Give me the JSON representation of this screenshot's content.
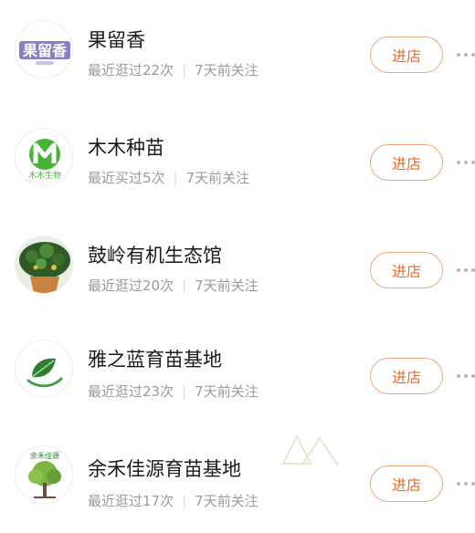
{
  "enter_label": "进店",
  "stores": [
    {
      "name": "果留香",
      "recent": "最近逛过22次",
      "follow": "7天前关注",
      "avatar_icon": "guoliuxiang-logo-icon",
      "logo_text": "果留香"
    },
    {
      "name": "木木种苗",
      "recent": "最近买过5次",
      "follow": "7天前关注",
      "avatar_icon": "mumu-logo-icon",
      "logo_text": "木木生物"
    },
    {
      "name": "鼓岭有机生态馆",
      "recent": "最近逛过20次",
      "follow": "7天前关注",
      "avatar_icon": "plant-photo-icon"
    },
    {
      "name": "雅之蓝育苗基地",
      "recent": "最近逛过23次",
      "follow": "7天前关注",
      "avatar_icon": "leaf-logo-icon"
    },
    {
      "name": "余禾佳源育苗基地",
      "recent": "最近逛过17次",
      "follow": "7天前关注",
      "avatar_icon": "tree-logo-icon",
      "logo_text": "余禾佳源"
    }
  ],
  "colors": {
    "accent": "#ee6a25",
    "button_border": "#f0a77c",
    "title": "#1a1a1a",
    "meta": "#9a9a9a"
  }
}
